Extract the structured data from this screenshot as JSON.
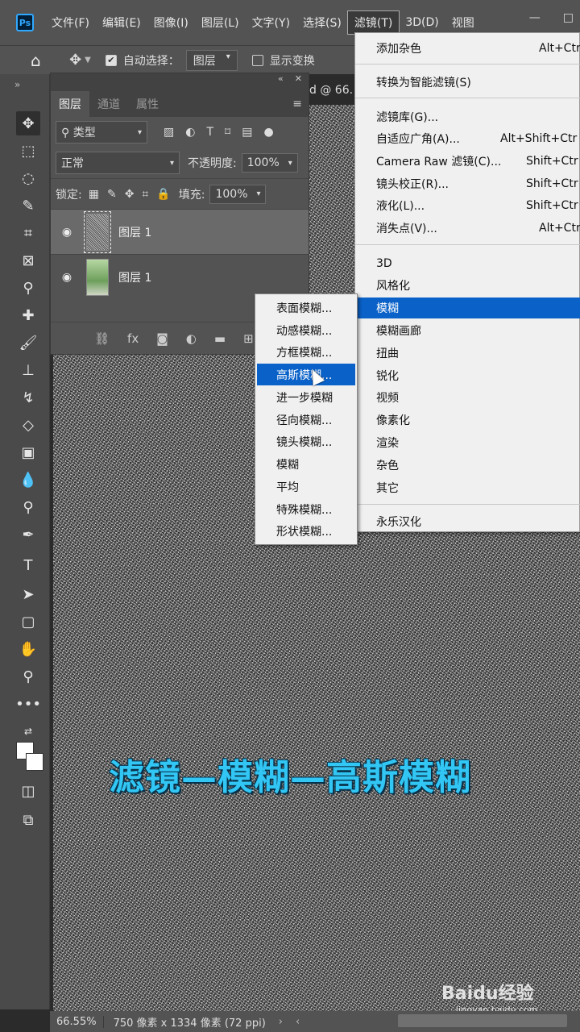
{
  "app": {
    "logo": "Ps"
  },
  "menubar": {
    "items": [
      "文件(F)",
      "编辑(E)",
      "图像(I)",
      "图层(L)",
      "文字(Y)",
      "选择(S)",
      "滤镜(T)",
      "3D(D)",
      "视图"
    ],
    "window_buttons": [
      "—",
      "□"
    ]
  },
  "options_bar": {
    "auto_select_label": "自动选择：",
    "auto_select_value": "图层",
    "show_transform_label": "显示变换"
  },
  "document_tab": {
    "title_fragment": "d @ 66."
  },
  "layers_panel": {
    "tabs": [
      "图层",
      "通道",
      "属性"
    ],
    "filter_kind": "类型",
    "blend_mode": "正常",
    "opacity_label": "不透明度:",
    "opacity_value": "100%",
    "lock_label": "锁定:",
    "fill_label": "填充:",
    "fill_value": "100%",
    "layers": [
      {
        "name": "图层 1",
        "selected": true
      },
      {
        "name": "图层 1",
        "selected": false
      }
    ]
  },
  "filter_menu": {
    "items": [
      {
        "label": "添加杂色",
        "shortcut": "Alt+Ctr"
      },
      {
        "label": "转换为智能滤镜(S)",
        "shortcut": ""
      },
      {
        "label": "滤镜库(G)...",
        "shortcut": ""
      },
      {
        "label": "自适应广角(A)...",
        "shortcut": "Alt+Shift+Ctr"
      },
      {
        "label": "Camera Raw 滤镜(C)...",
        "shortcut": "Shift+Ctr"
      },
      {
        "label": "镜头校正(R)...",
        "shortcut": "Shift+Ctr"
      },
      {
        "label": "液化(L)...",
        "shortcut": "Shift+Ctr"
      },
      {
        "label": "消失点(V)...",
        "shortcut": "Alt+Ctr"
      },
      {
        "label": "3D",
        "shortcut": ""
      },
      {
        "label": "风格化",
        "shortcut": ""
      },
      {
        "label": "模糊",
        "shortcut": ""
      },
      {
        "label": "模糊画廊",
        "shortcut": ""
      },
      {
        "label": "扭曲",
        "shortcut": ""
      },
      {
        "label": "锐化",
        "shortcut": ""
      },
      {
        "label": "视频",
        "shortcut": ""
      },
      {
        "label": "像素化",
        "shortcut": ""
      },
      {
        "label": "渲染",
        "shortcut": ""
      },
      {
        "label": "杂色",
        "shortcut": ""
      },
      {
        "label": "其它",
        "shortcut": ""
      },
      {
        "label": "永乐汉化",
        "shortcut": ""
      }
    ],
    "highlighted": "模糊"
  },
  "blur_submenu": {
    "items": [
      "表面模糊...",
      "动感模糊...",
      "方框模糊...",
      "高斯模糊...",
      "进一步模糊",
      "径向模糊...",
      "镜头模糊...",
      "模糊",
      "平均",
      "特殊模糊...",
      "形状模糊..."
    ],
    "highlighted": "高斯模糊..."
  },
  "caption": "滤镜—模糊—高斯模糊",
  "status_bar": {
    "zoom": "66.55%",
    "doc_info": "750 像素 x 1334 像素 (72 ppi)"
  },
  "watermark": {
    "logo_text": "Baidu经验",
    "url": "jingyan.baidu.com"
  },
  "colors": {
    "accent": "#0a62c9",
    "caption": "#32c6f4",
    "ps_blue": "#31a8ff"
  }
}
